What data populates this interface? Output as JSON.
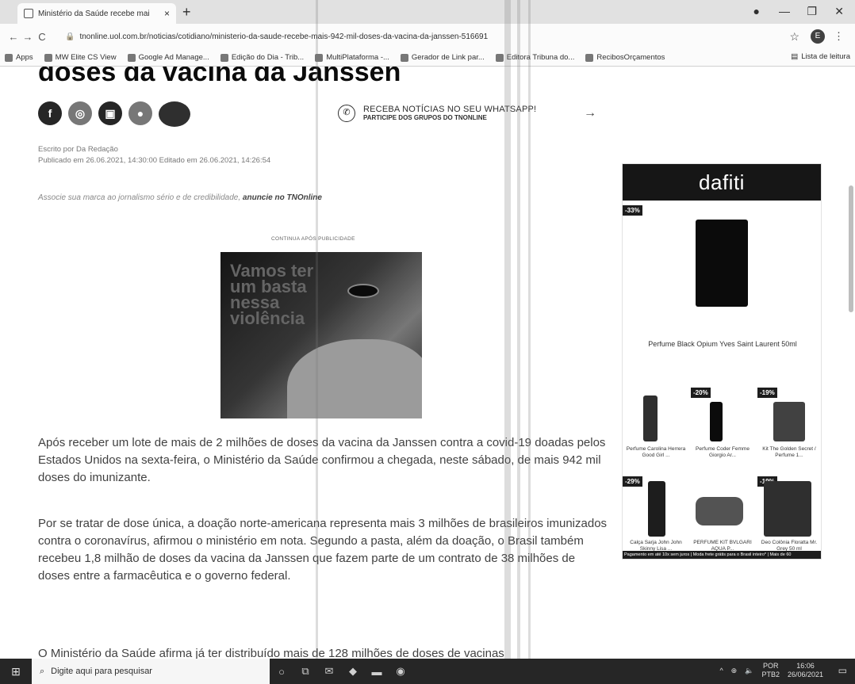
{
  "browser": {
    "tab_title": "Ministério da Saúde recebe mai",
    "tab_close": "×",
    "new_tab": "+",
    "url": "tnonline.uol.com.br/noticias/cotidiano/ministerio-da-saude-recebe-mais-942-mil-doses-da-vacina-da-janssen-516691",
    "profile_initial": "E",
    "bookmarks": [
      "Apps",
      "MW Elite CS View",
      "Google Ad Manage...",
      "Edição do Dia - Trib...",
      "MultiPlataforma -...",
      "Gerador de Link par...",
      "Editora Tribuna do...",
      "RecibosOrçamentos"
    ],
    "reading_list": "Lista de leitura"
  },
  "article": {
    "headline": "doses da vacina da Janssen",
    "whatsapp_title": "RECEBA NOTÍCIAS NO SEU WHATSAPP!",
    "whatsapp_sub": "PARTICIPE DOS GRUPOS DO TNONLINE",
    "author": "Escrito por Da Redação",
    "published": "Publicado em 26.06.2021, 14:30:00   Editado em 26.06.2021, 14:26:54",
    "promo_text": "Associe sua marca ao jornalismo sério e de credibilidade,",
    "promo_link": "anuncie no TNOnline",
    "ad_label": "CONTINUA APÓS PUBLICIDADE",
    "photo_text": "Vamos ter um basta nessa violência",
    "p1": "Após receber um lote de mais de 2 milhões de doses da vacina da Janssen contra a covid-19 doadas pelos Estados Unidos na sexta-feira, o Ministério da Saúde confirmou a chegada, neste sábado, de mais 942 mil doses do imunizante.",
    "p2": "Por se tratar de dose única, a doação norte-americana representa mais 3 milhões de brasileiros imunizados contra o coronavírus, afirmou o ministério em nota. Segundo a pasta, além da doação, o Brasil também recebeu 1,8 milhão de doses da vacina da Janssen que fazem parte de um contrato de 38 milhões de doses entre a farmacêutica e o governo federal.",
    "p3": "O Ministério da Saúde afirma já ter distribuído mais de 128 milhões de doses de vacinas"
  },
  "ad": {
    "brand": "dafiti",
    "main_discount": "-33%",
    "main_product": "Perfume Black Opium Yves Saint Laurent 50ml",
    "products": [
      {
        "name": "Perfume Carolina Herrera Good Girl ...",
        "discount": ""
      },
      {
        "name": "Perfume Coder Femme Giorgio Ar...",
        "discount": "-20%"
      },
      {
        "name": "Kit The Golden Secret / Perfume 1...",
        "discount": "-19%"
      },
      {
        "name": "Calça Sarja John John Skinny Lisa ...",
        "discount": "-29%"
      },
      {
        "name": "PERFUME KIT BVLGARI AQUA P...",
        "discount": ""
      },
      {
        "name": "Deo Colônia Floratta Mr. Grey 50 ml",
        "discount": "-19%"
      }
    ],
    "ticker": "Pagamento em até 10x sem juros | Moda frete grátis para o Brasil inteiro* | Mais de 60"
  },
  "taskbar": {
    "search_placeholder": "Digite aqui para pesquisar",
    "lang": "POR",
    "lang_sub": "PTB2",
    "time": "16:06",
    "date": "26/06/2021"
  }
}
